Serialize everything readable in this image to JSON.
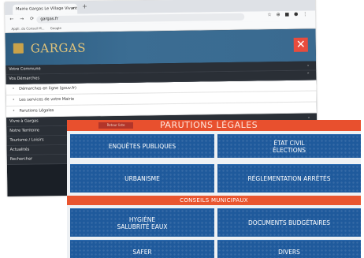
{
  "browser": {
    "tab_title": "Mairie Gargas Le Village Vivant",
    "tab_close": "×",
    "new_tab": "+",
    "url": "gargas.fr",
    "nav_glyphs": "← → ⟳",
    "toolbar_glyphs": "☆ ⊕ ■ ⬢ ⋮",
    "bookmarks": [
      "Appli. du Conseil M...",
      "Google"
    ]
  },
  "site": {
    "title": "GARGAS",
    "close": "✕",
    "menu": [
      {
        "label": "Votre Commune",
        "chevron": "⌄"
      },
      {
        "label": "Vos Démarches",
        "chevron": "⌃"
      }
    ],
    "submenu": [
      {
        "bullet": "•",
        "label": "Démarches en ligne (gouv.fr)"
      },
      {
        "bullet": "•",
        "label": "Les services de votre Mairie"
      },
      {
        "bullet": "•",
        "label": "Parutions Légales"
      }
    ],
    "menu_after": [
      {
        "label": "Vivre à Gargas",
        "chevron": "⌄"
      },
      {
        "label": "Notre Territoire",
        "chevron": ""
      },
      {
        "label": "Tourisme / Loisirs",
        "chevron": ""
      },
      {
        "label": "Actualités",
        "chevron": ""
      },
      {
        "label": "Rechercher",
        "chevron": ""
      }
    ]
  },
  "flyer": {
    "tag": "Retour liste",
    "title": "PARUTIONS LÉGALES",
    "tiles": [
      {
        "lines": [
          "ENQUÊTES PUBLIQUES"
        ]
      },
      {
        "lines": [
          "ÉTAT CIVIL",
          "ÉLECTIONS"
        ]
      },
      {
        "lines": [
          "URBANISME"
        ]
      },
      {
        "lines": [
          "RÉGLEMENTATION ARRÊTÉS"
        ]
      },
      {
        "lines": [
          "HYGIÈNE",
          "SALUBRITÉ EAUX"
        ]
      },
      {
        "lines": [
          "DOCUMENTS BUDGÉTAIRES"
        ]
      },
      {
        "lines": [
          "SAFER"
        ]
      },
      {
        "lines": [
          "DIVERS"
        ]
      }
    ],
    "band": "CONSEILS MUNICIPAUX"
  },
  "colors": {
    "header_blue": "#3b6d93",
    "gold": "#e2c47a",
    "close_red": "#e84c3d",
    "tile_blue": "#1f5a9c",
    "orange": "#e8502e"
  }
}
